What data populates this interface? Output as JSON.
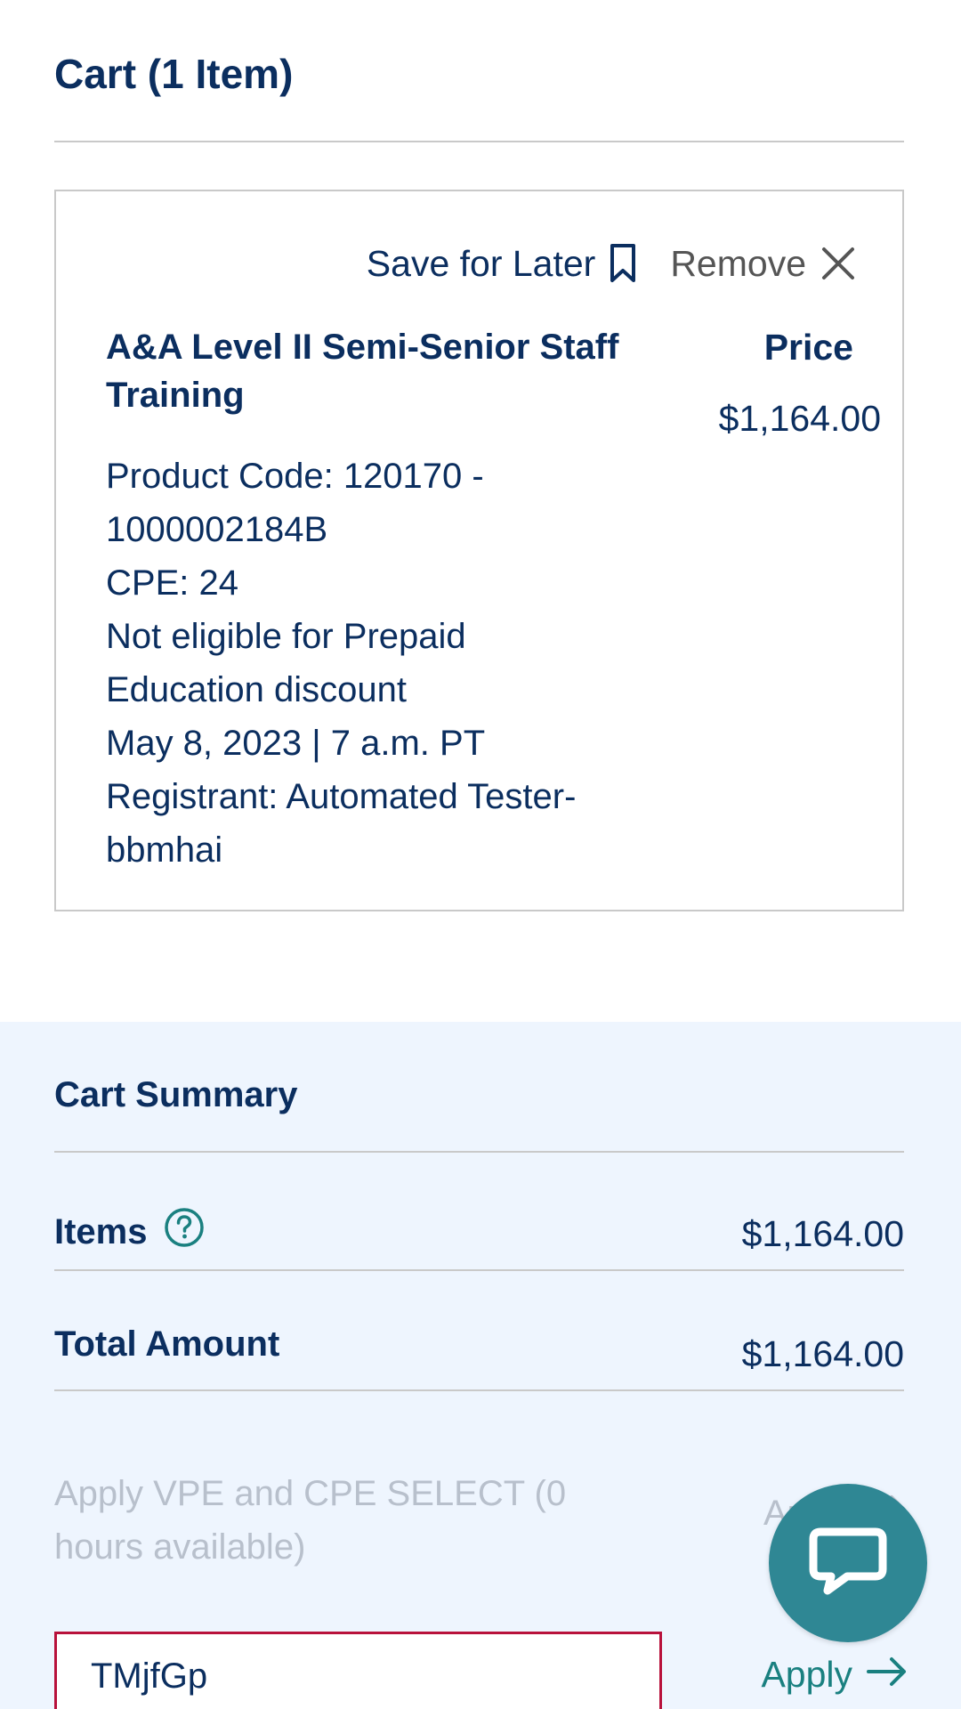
{
  "cart": {
    "title": "Cart (1 Item)"
  },
  "item": {
    "save_for_later_label": "Save for Later",
    "remove_label": "Remove",
    "title": "A&A Level II Semi-Senior Staff Training",
    "details": [
      "Product Code: 120170 - 1000002184B",
      "CPE: 24",
      "Not eligible for Prepaid Education discount",
      "May 8, 2023 | 7 a.m. PT",
      "Registrant: Automated Tester-bbmhai"
    ],
    "price_label": "Price",
    "price_value": "$1,164.00",
    "icons": [
      "bookmark-icon",
      "close-icon"
    ]
  },
  "summary": {
    "title": "Cart Summary",
    "items_label": "Items",
    "items_value": "$1,164.00",
    "total_label": "Total Amount",
    "total_value": "$1,164.00",
    "vpe_text": "Apply VPE and CPE SELECT (0 hours available)",
    "vpe_apply_label": "Apply",
    "promo_value": "TMjfGp",
    "promo_apply_label": "Apply"
  },
  "colors": {
    "navy": "#0b2e5f",
    "teal": "#1a8080",
    "summary_bg": "#eef5fe",
    "error_border": "#b8113b",
    "chat_bg": "#2f8794",
    "disabled_text": "#b8c0cc"
  }
}
